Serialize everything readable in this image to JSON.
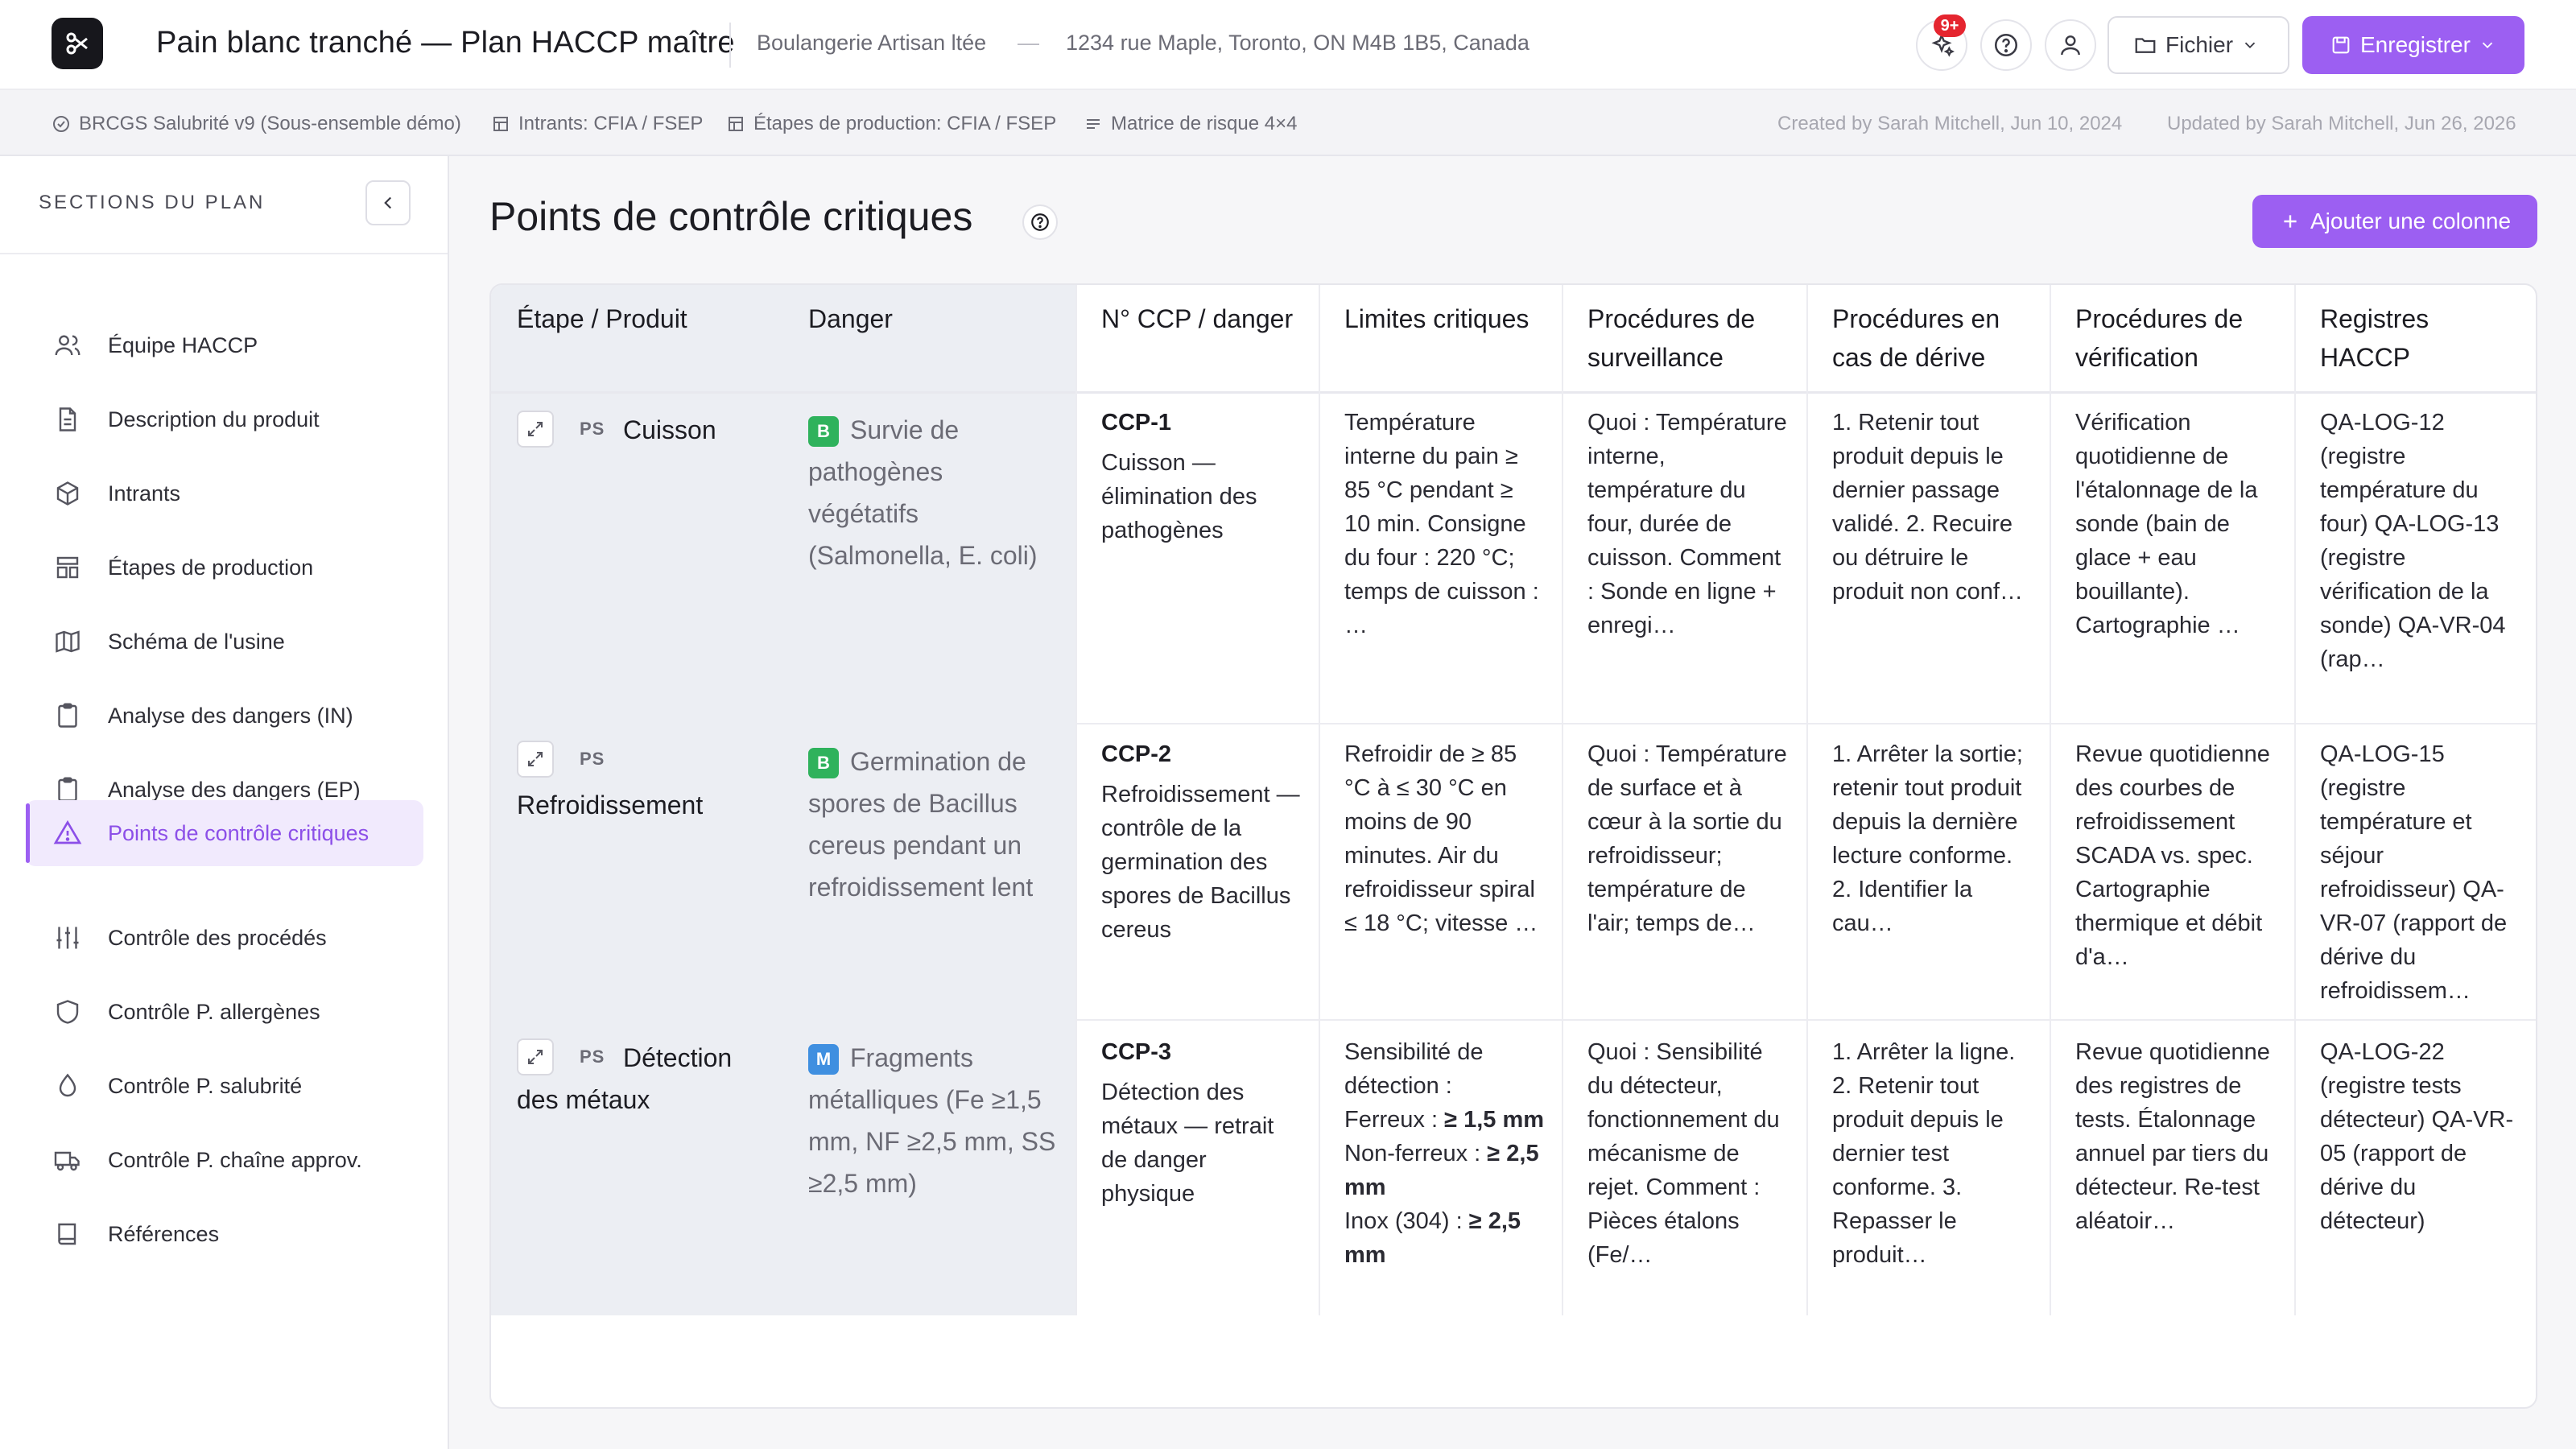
{
  "header": {
    "title": "Pain blanc tranché — Plan HACCP maître",
    "company": "Boulangerie Artisan ltée",
    "separator": "—",
    "address": "1234 rue Maple, Toronto, ON M4B 1B5, Canada",
    "notif_count": "9+",
    "file_label": "Fichier",
    "save_label": "Enregistrer"
  },
  "subbar": {
    "standard": "BRCGS Salubrité v9 (Sous-ensemble démo)",
    "inputs": "Intrants: CFIA / FSEP",
    "steps": "Étapes de production: CFIA / FSEP",
    "matrix": "Matrice de risque 4×4",
    "created": "Created by Sarah Mitchell, Jun 10, 2024",
    "updated": "Updated by Sarah Mitchell, Jun 26, 2026"
  },
  "sidebar": {
    "heading": "SECTIONS DU PLAN",
    "items": [
      {
        "label": "Équipe HACCP",
        "icon": "users-icon"
      },
      {
        "label": "Description du produit",
        "icon": "document-icon"
      },
      {
        "label": "Intrants",
        "icon": "box-icon"
      },
      {
        "label": "Étapes de production",
        "icon": "layout-icon"
      },
      {
        "label": "Schéma de l'usine",
        "icon": "map-icon"
      },
      {
        "label": "Analyse des dangers (IN)",
        "icon": "clipboard-icon"
      },
      {
        "label": "Analyse des dangers (EP)",
        "icon": "clipboard-icon"
      },
      {
        "label": "Points de contrôle critiques",
        "icon": "warning-icon",
        "active": true
      },
      {
        "label": "Contrôle des procédés",
        "icon": "sliders-icon"
      },
      {
        "label": "Contrôle P. allergènes",
        "icon": "shield-icon"
      },
      {
        "label": "Contrôle P. salubrité",
        "icon": "droplet-icon"
      },
      {
        "label": "Contrôle P. chaîne approv.",
        "icon": "truck-icon"
      },
      {
        "label": "Références",
        "icon": "book-icon"
      }
    ]
  },
  "main": {
    "title": "Points de contrôle critiques",
    "add_column": "Ajouter une colonne",
    "columns": [
      "Étape / Produit",
      "Danger",
      "N° CCP / danger",
      "Limites critiques",
      "Procédures de surveillance",
      "Procédures en cas de dérive",
      "Procédures de vérification",
      "Registres HACCP"
    ],
    "rows": [
      {
        "ps": "PS",
        "step": "Cuisson",
        "badge": "B",
        "danger": "Survie de pathogènes végétatifs (Salmonella, E. coli)",
        "ccp": "CCP-1",
        "ccp_desc": "Cuisson — élimination des pathogènes",
        "limits": "Température interne du pain ≥ 85 °C pendant ≥ 10 min. Consigne du four : 220 °C; temps de cuisson : …",
        "monitoring": "Quoi : Température interne, température du four, durée de cuisson. Comment : Sonde en ligne + enregi…",
        "deviation": "1. Retenir tout produit depuis le dernier passage validé. 2. Recuire ou détruire le produit non conf…",
        "verification": "Vérification quotidienne de l'étalonnage de la sonde (bain de glace + eau bouillante). Cartographie …",
        "records": "QA-LOG-12 (registre température du four) QA-LOG-13 (registre vérification de la sonde) QA-VR-04 (rap…"
      },
      {
        "ps": "PS",
        "step": "Refroidissement",
        "badge": "B",
        "danger": "Germination de spores de Bacillus cereus pendant un refroidissement lent",
        "ccp": "CCP-2",
        "ccp_desc": "Refroidissement — contrôle de la germination des spores de Bacillus cereus",
        "limits": "Refroidir de ≥ 85 °C à ≤ 30 °C en moins de 90 minutes. Air du refroidisseur spiral ≤ 18 °C; vitesse …",
        "monitoring": "Quoi : Température de surface et à cœur à la sortie du refroidisseur; température de l'air; temps de…",
        "deviation": "1. Arrêter la sortie; retenir tout produit depuis la dernière lecture conforme. 2. Identifier la cau…",
        "verification": "Revue quotidienne des courbes de refroidissement SCADA vs. spec. Cartographie thermique et débit d'a…",
        "records": "QA-LOG-15 (registre température et séjour refroidisseur) QA-VR-07 (rapport de dérive du refroidissem…"
      },
      {
        "ps": "PS",
        "step": "Détection des métaux",
        "badge": "M",
        "danger": "Fragments métalliques (Fe ≥1,5 mm, NF ≥2,5 mm, SS ≥2,5 mm)",
        "ccp": "CCP-3",
        "ccp_desc": "Détection des métaux — retrait de danger physique",
        "limits_intro": "Sensibilité de détection :",
        "limits_items": [
          {
            "label": "Ferreux : ",
            "value": "≥ 1,5 mm"
          },
          {
            "label": "Non-ferreux : ",
            "value": "≥ 2,5 mm"
          },
          {
            "label": "Inox (304) : ",
            "value": "≥ 2,5 mm"
          }
        ],
        "monitoring": "Quoi : Sensibilité du détecteur, fonctionnement du mécanisme de rejet. Comment : Pièces étalons (Fe/…",
        "deviation": "1. Arrêter la ligne. 2. Retenir tout produit depuis le dernier test conforme. 3. Repasser le produit…",
        "verification": "Revue quotidienne des registres de tests. Étalonnage annuel par tiers du détecteur. Re-test aléatoir…",
        "records": "QA-LOG-22 (registre tests détecteur) QA-VR-05 (rapport de dérive du détecteur)"
      }
    ]
  },
  "colors": {
    "accent": "#9c5ff2",
    "badge_bio": "#2fb25c",
    "badge_phys": "#3f8fe0",
    "notif": "#e5252f"
  }
}
